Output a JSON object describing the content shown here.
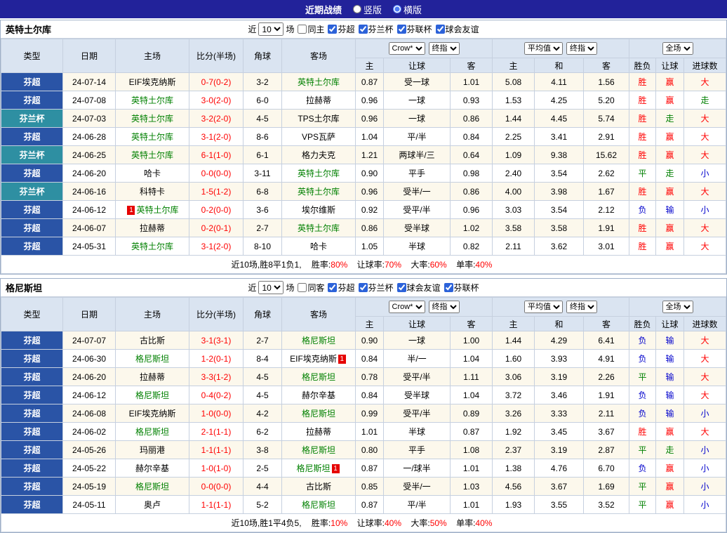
{
  "titlebar": {
    "title": "近期战绩",
    "layouts": [
      {
        "label": "竖版",
        "checked": false
      },
      {
        "label": "横版",
        "checked": true
      }
    ]
  },
  "columns": {
    "type": "类型",
    "date": "日期",
    "home": "主场",
    "score": "比分(半场)",
    "corner": "角球",
    "away": "客场",
    "company_select": "Crow*",
    "final_select_1": "终指",
    "average_select": "平均值",
    "final_select_2": "终指",
    "fulltime_select": "全场",
    "sub": [
      "主",
      "让球",
      "客",
      "主",
      "和",
      "客",
      "胜负",
      "让球",
      "进球数"
    ]
  },
  "colors": {
    "topbar_bg": "#22229a",
    "header_bg": "#dae4f1",
    "grid_border": "#c6d0df",
    "stripe_bg": "#fcf8ec",
    "super_league_bg": "#2a54a6",
    "cup_bg": "#2e8fa2",
    "score_color": "#ff0000",
    "focus_team": "#008000",
    "win_color": "#ff0000",
    "draw_color": "#008000",
    "lose_color": "#0000cc"
  },
  "sections": [
    {
      "team": "英特土尔库",
      "controls": {
        "near": "近",
        "count": "10",
        "matches": "场",
        "same": {
          "label": "同主",
          "checked": false
        },
        "leagues": [
          {
            "label": "芬超",
            "checked": true
          },
          {
            "label": "芬兰杯",
            "checked": true
          },
          {
            "label": "芬联杯",
            "checked": true
          },
          {
            "label": "球会友谊",
            "checked": true
          }
        ]
      },
      "rows": [
        {
          "league": "芬超",
          "lt": "super",
          "date": "24-07-14",
          "home": {
            "name": "EIF埃克纳斯"
          },
          "score": "0-7(0-2)",
          "corner": "3-2",
          "away": {
            "name": "英特土尔库",
            "focus": true
          },
          "odds": [
            "0.87",
            "受一球",
            "1.01"
          ],
          "avg": [
            "5.08",
            "4.11",
            "1.56"
          ],
          "res": [
            {
              "t": "胜",
              "c": "r"
            },
            {
              "t": "赢",
              "c": "r"
            },
            {
              "t": "大",
              "c": "r"
            }
          ]
        },
        {
          "league": "芬超",
          "lt": "super",
          "date": "24-07-08",
          "home": {
            "name": "英特土尔库",
            "focus": true
          },
          "score": "3-0(2-0)",
          "corner": "6-0",
          "away": {
            "name": "拉赫蒂"
          },
          "odds": [
            "0.96",
            "一球",
            "0.93"
          ],
          "avg": [
            "1.53",
            "4.25",
            "5.20"
          ],
          "res": [
            {
              "t": "胜",
              "c": "r"
            },
            {
              "t": "赢",
              "c": "r"
            },
            {
              "t": "走",
              "c": "g"
            }
          ]
        },
        {
          "league": "芬兰杯",
          "lt": "cup",
          "date": "24-07-03",
          "home": {
            "name": "英特土尔库",
            "focus": true
          },
          "score": "3-2(2-0)",
          "corner": "4-5",
          "away": {
            "name": "TPS土尔库"
          },
          "odds": [
            "0.96",
            "一球",
            "0.86"
          ],
          "avg": [
            "1.44",
            "4.45",
            "5.74"
          ],
          "res": [
            {
              "t": "胜",
              "c": "r"
            },
            {
              "t": "走",
              "c": "g"
            },
            {
              "t": "大",
              "c": "r"
            }
          ]
        },
        {
          "league": "芬超",
          "lt": "super",
          "date": "24-06-28",
          "home": {
            "name": "英特土尔库",
            "focus": true
          },
          "score": "3-1(2-0)",
          "corner": "8-6",
          "away": {
            "name": "VPS瓦萨"
          },
          "odds": [
            "1.04",
            "平/半",
            "0.84"
          ],
          "avg": [
            "2.25",
            "3.41",
            "2.91"
          ],
          "res": [
            {
              "t": "胜",
              "c": "r"
            },
            {
              "t": "赢",
              "c": "r"
            },
            {
              "t": "大",
              "c": "r"
            }
          ]
        },
        {
          "league": "芬兰杯",
          "lt": "cup",
          "date": "24-06-25",
          "home": {
            "name": "英特土尔库",
            "focus": true
          },
          "score": "6-1(1-0)",
          "corner": "6-1",
          "away": {
            "name": "格力夫克"
          },
          "odds": [
            "1.21",
            "两球半/三",
            "0.64"
          ],
          "avg": [
            "1.09",
            "9.38",
            "15.62"
          ],
          "res": [
            {
              "t": "胜",
              "c": "r"
            },
            {
              "t": "赢",
              "c": "r"
            },
            {
              "t": "大",
              "c": "r"
            }
          ]
        },
        {
          "league": "芬超",
          "lt": "super",
          "date": "24-06-20",
          "home": {
            "name": "哈卡"
          },
          "score": "0-0(0-0)",
          "corner": "3-11",
          "away": {
            "name": "英特土尔库",
            "focus": true
          },
          "odds": [
            "0.90",
            "平手",
            "0.98"
          ],
          "avg": [
            "2.40",
            "3.54",
            "2.62"
          ],
          "res": [
            {
              "t": "平",
              "c": "g"
            },
            {
              "t": "走",
              "c": "g"
            },
            {
              "t": "小",
              "c": "b"
            }
          ]
        },
        {
          "league": "芬兰杯",
          "lt": "cup",
          "date": "24-06-16",
          "home": {
            "name": "科特卡"
          },
          "score": "1-5(1-2)",
          "corner": "6-8",
          "away": {
            "name": "英特土尔库",
            "focus": true
          },
          "odds": [
            "0.96",
            "受半/一",
            "0.86"
          ],
          "avg": [
            "4.00",
            "3.98",
            "1.67"
          ],
          "res": [
            {
              "t": "胜",
              "c": "r"
            },
            {
              "t": "赢",
              "c": "r"
            },
            {
              "t": "大",
              "c": "r"
            }
          ]
        },
        {
          "league": "芬超",
          "lt": "super",
          "date": "24-06-12",
          "home": {
            "name": "英特土尔库",
            "focus": true,
            "badge": "1",
            "badge_pos": "l"
          },
          "score": "0-2(0-0)",
          "corner": "3-6",
          "away": {
            "name": "埃尔维斯"
          },
          "odds": [
            "0.92",
            "受平/半",
            "0.96"
          ],
          "avg": [
            "3.03",
            "3.54",
            "2.12"
          ],
          "res": [
            {
              "t": "负",
              "c": "b"
            },
            {
              "t": "输",
              "c": "b"
            },
            {
              "t": "小",
              "c": "b"
            }
          ]
        },
        {
          "league": "芬超",
          "lt": "super",
          "date": "24-06-07",
          "home": {
            "name": "拉赫蒂"
          },
          "score": "0-2(0-1)",
          "corner": "2-7",
          "away": {
            "name": "英特土尔库",
            "focus": true
          },
          "odds": [
            "0.86",
            "受半球",
            "1.02"
          ],
          "avg": [
            "3.58",
            "3.58",
            "1.91"
          ],
          "res": [
            {
              "t": "胜",
              "c": "r"
            },
            {
              "t": "赢",
              "c": "r"
            },
            {
              "t": "大",
              "c": "r"
            }
          ]
        },
        {
          "league": "芬超",
          "lt": "super",
          "date": "24-05-31",
          "home": {
            "name": "英特土尔库",
            "focus": true
          },
          "score": "3-1(2-0)",
          "corner": "8-10",
          "away": {
            "name": "哈卡"
          },
          "odds": [
            "1.05",
            "半球",
            "0.82"
          ],
          "avg": [
            "2.11",
            "3.62",
            "3.01"
          ],
          "res": [
            {
              "t": "胜",
              "c": "r"
            },
            {
              "t": "赢",
              "c": "r"
            },
            {
              "t": "大",
              "c": "r"
            }
          ]
        }
      ],
      "footer": {
        "summary": "近10场,胜8平1负1,",
        "stats": [
          {
            "label": "胜率:",
            "value": "80%"
          },
          {
            "label": "让球率:",
            "value": "70%"
          },
          {
            "label": "大率:",
            "value": "60%"
          },
          {
            "label": "单率:",
            "value": "40%"
          }
        ]
      }
    },
    {
      "team": "格尼斯坦",
      "controls": {
        "near": "近",
        "count": "10",
        "matches": "场",
        "same": {
          "label": "同客",
          "checked": false
        },
        "leagues": [
          {
            "label": "芬超",
            "checked": true
          },
          {
            "label": "芬兰杯",
            "checked": true
          },
          {
            "label": "球会友谊",
            "checked": true
          },
          {
            "label": "芬联杯",
            "checked": true
          }
        ]
      },
      "rows": [
        {
          "league": "芬超",
          "lt": "super",
          "date": "24-07-07",
          "home": {
            "name": "古比斯"
          },
          "score": "3-1(3-1)",
          "corner": "2-7",
          "away": {
            "name": "格尼斯坦",
            "focus": true
          },
          "odds": [
            "0.90",
            "一球",
            "1.00"
          ],
          "avg": [
            "1.44",
            "4.29",
            "6.41"
          ],
          "res": [
            {
              "t": "负",
              "c": "b"
            },
            {
              "t": "输",
              "c": "b"
            },
            {
              "t": "大",
              "c": "r"
            }
          ]
        },
        {
          "league": "芬超",
          "lt": "super",
          "date": "24-06-30",
          "home": {
            "name": "格尼斯坦",
            "focus": true
          },
          "score": "1-2(0-1)",
          "corner": "8-4",
          "away": {
            "name": "EIF埃克纳斯",
            "badge": "1",
            "badge_pos": "r"
          },
          "odds": [
            "0.84",
            "半/一",
            "1.04"
          ],
          "avg": [
            "1.60",
            "3.93",
            "4.91"
          ],
          "res": [
            {
              "t": "负",
              "c": "b"
            },
            {
              "t": "输",
              "c": "b"
            },
            {
              "t": "大",
              "c": "r"
            }
          ]
        },
        {
          "league": "芬超",
          "lt": "super",
          "date": "24-06-20",
          "home": {
            "name": "拉赫蒂"
          },
          "score": "3-3(1-2)",
          "corner": "4-5",
          "away": {
            "name": "格尼斯坦",
            "focus": true
          },
          "odds": [
            "0.78",
            "受平/半",
            "1.11"
          ],
          "avg": [
            "3.06",
            "3.19",
            "2.26"
          ],
          "res": [
            {
              "t": "平",
              "c": "g"
            },
            {
              "t": "输",
              "c": "b"
            },
            {
              "t": "大",
              "c": "r"
            }
          ]
        },
        {
          "league": "芬超",
          "lt": "super",
          "date": "24-06-12",
          "home": {
            "name": "格尼斯坦",
            "focus": true
          },
          "score": "0-4(0-2)",
          "corner": "4-5",
          "away": {
            "name": "赫尔辛基"
          },
          "odds": [
            "0.84",
            "受半球",
            "1.04"
          ],
          "avg": [
            "3.72",
            "3.46",
            "1.91"
          ],
          "res": [
            {
              "t": "负",
              "c": "b"
            },
            {
              "t": "输",
              "c": "b"
            },
            {
              "t": "大",
              "c": "r"
            }
          ]
        },
        {
          "league": "芬超",
          "lt": "super",
          "date": "24-06-08",
          "home": {
            "name": "EIF埃克纳斯"
          },
          "score": "1-0(0-0)",
          "corner": "4-2",
          "away": {
            "name": "格尼斯坦",
            "focus": true
          },
          "odds": [
            "0.99",
            "受平/半",
            "0.89"
          ],
          "avg": [
            "3.26",
            "3.33",
            "2.11"
          ],
          "res": [
            {
              "t": "负",
              "c": "b"
            },
            {
              "t": "输",
              "c": "b"
            },
            {
              "t": "小",
              "c": "b"
            }
          ]
        },
        {
          "league": "芬超",
          "lt": "super",
          "date": "24-06-02",
          "home": {
            "name": "格尼斯坦",
            "focus": true
          },
          "score": "2-1(1-1)",
          "corner": "6-2",
          "away": {
            "name": "拉赫蒂"
          },
          "odds": [
            "1.01",
            "半球",
            "0.87"
          ],
          "avg": [
            "1.92",
            "3.45",
            "3.67"
          ],
          "res": [
            {
              "t": "胜",
              "c": "r"
            },
            {
              "t": "赢",
              "c": "r"
            },
            {
              "t": "大",
              "c": "r"
            }
          ]
        },
        {
          "league": "芬超",
          "lt": "super",
          "date": "24-05-26",
          "home": {
            "name": "玛丽港"
          },
          "score": "1-1(1-1)",
          "corner": "3-8",
          "away": {
            "name": "格尼斯坦",
            "focus": true
          },
          "odds": [
            "0.80",
            "平手",
            "1.08"
          ],
          "avg": [
            "2.37",
            "3.19",
            "2.87"
          ],
          "res": [
            {
              "t": "平",
              "c": "g"
            },
            {
              "t": "走",
              "c": "g"
            },
            {
              "t": "小",
              "c": "b"
            }
          ]
        },
        {
          "league": "芬超",
          "lt": "super",
          "date": "24-05-22",
          "home": {
            "name": "赫尔辛基"
          },
          "score": "1-0(1-0)",
          "corner": "2-5",
          "away": {
            "name": "格尼斯坦",
            "focus": true,
            "badge": "1",
            "badge_pos": "r"
          },
          "odds": [
            "0.87",
            "一/球半",
            "1.01"
          ],
          "avg": [
            "1.38",
            "4.76",
            "6.70"
          ],
          "res": [
            {
              "t": "负",
              "c": "b"
            },
            {
              "t": "赢",
              "c": "r"
            },
            {
              "t": "小",
              "c": "b"
            }
          ]
        },
        {
          "league": "芬超",
          "lt": "super",
          "date": "24-05-19",
          "home": {
            "name": "格尼斯坦",
            "focus": true
          },
          "score": "0-0(0-0)",
          "corner": "4-4",
          "away": {
            "name": "古比斯"
          },
          "odds": [
            "0.85",
            "受半/一",
            "1.03"
          ],
          "avg": [
            "4.56",
            "3.67",
            "1.69"
          ],
          "res": [
            {
              "t": "平",
              "c": "g"
            },
            {
              "t": "赢",
              "c": "r"
            },
            {
              "t": "小",
              "c": "b"
            }
          ]
        },
        {
          "league": "芬超",
          "lt": "super",
          "date": "24-05-11",
          "home": {
            "name": "奥卢"
          },
          "score": "1-1(1-1)",
          "corner": "5-2",
          "away": {
            "name": "格尼斯坦",
            "focus": true
          },
          "odds": [
            "0.87",
            "平/半",
            "1.01"
          ],
          "avg": [
            "1.93",
            "3.55",
            "3.52"
          ],
          "res": [
            {
              "t": "平",
              "c": "g"
            },
            {
              "t": "赢",
              "c": "r"
            },
            {
              "t": "小",
              "c": "b"
            }
          ]
        }
      ],
      "footer": {
        "summary": "近10场,胜1平4负5,",
        "stats": [
          {
            "label": "胜率:",
            "value": "10%"
          },
          {
            "label": "让球率:",
            "value": "40%"
          },
          {
            "label": "大率:",
            "value": "50%"
          },
          {
            "label": "单率:",
            "value": "40%"
          }
        ]
      }
    }
  ]
}
